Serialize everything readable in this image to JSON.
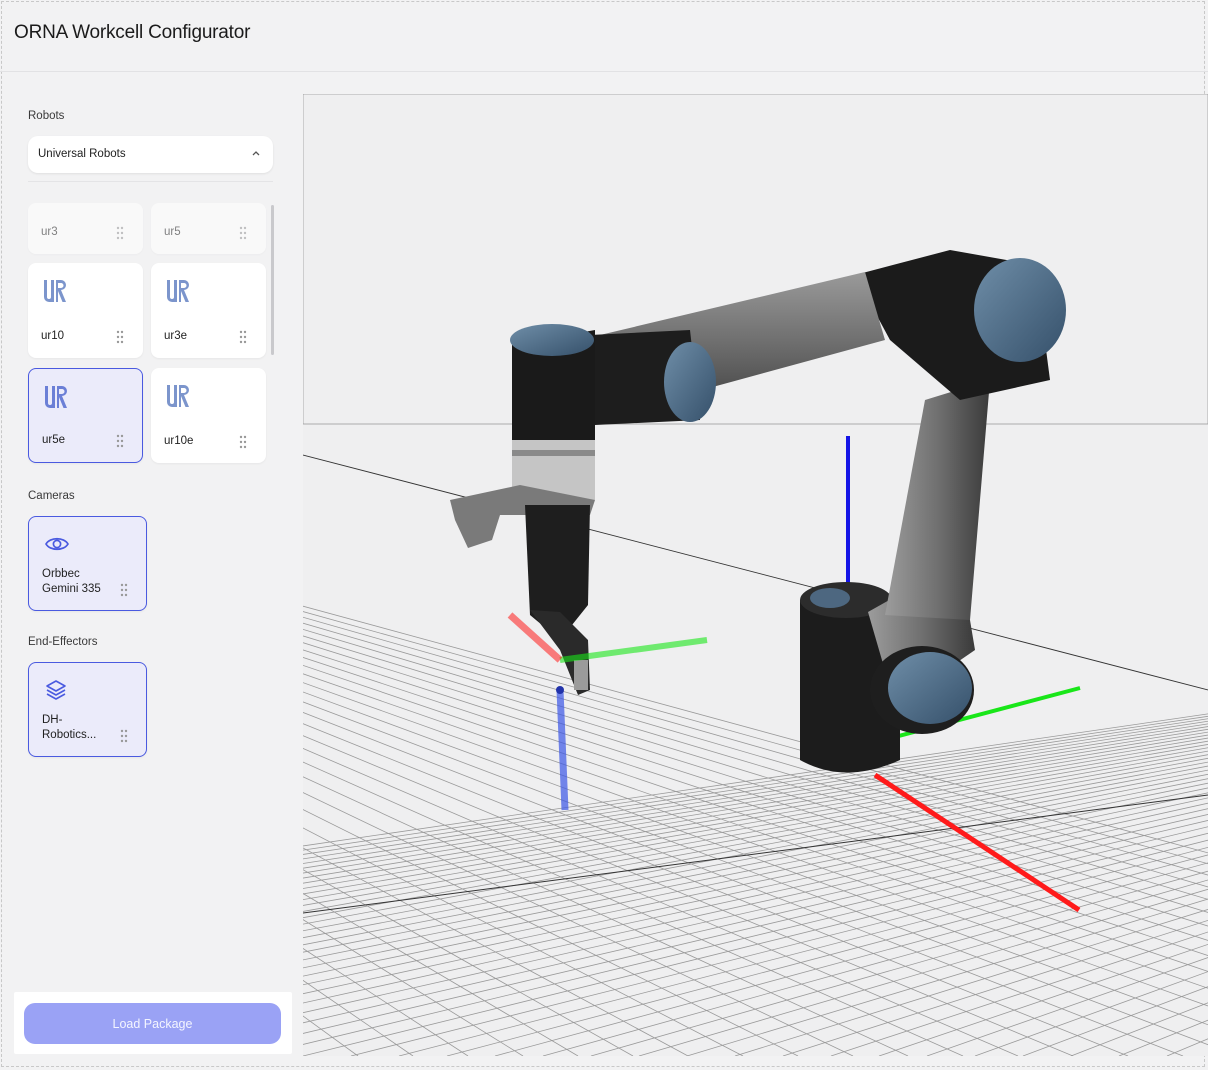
{
  "app": {
    "title": "ORNA Workcell Configurator"
  },
  "sidebar": {
    "robots_label": "Robots",
    "robot_brand_select": {
      "value": "Universal Robots"
    },
    "robots": [
      {
        "name": "ur3",
        "selected": false,
        "partially_visible": true
      },
      {
        "name": "ur5",
        "selected": false,
        "partially_visible": true
      },
      {
        "name": "ur10",
        "selected": false
      },
      {
        "name": "ur3e",
        "selected": false
      },
      {
        "name": "ur5e",
        "selected": true
      },
      {
        "name": "ur10e",
        "selected": false
      }
    ],
    "cameras_label": "Cameras",
    "cameras": [
      {
        "line1": "Orbbec",
        "line2": "Gemini 335",
        "icon": "eye-icon",
        "selected": true
      }
    ],
    "end_effectors_label": "End-Effectors",
    "end_effectors": [
      {
        "line1": "DH-",
        "line2": "Robotics...",
        "icon": "layers-icon",
        "selected": true
      }
    ],
    "load_button": "Load Package"
  },
  "viewport": {
    "scene": "3D robot workcell view",
    "axis_colors": {
      "x": "#ff1a1a",
      "y": "#19e619",
      "z": "#1414e6"
    },
    "accent": "#4a5ae0"
  }
}
